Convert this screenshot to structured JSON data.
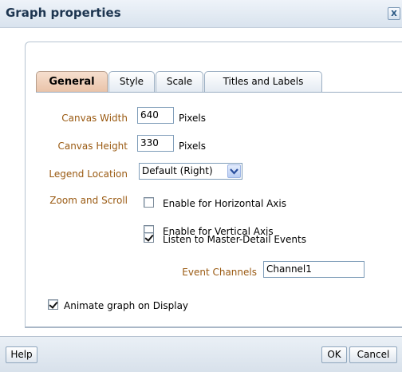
{
  "dialog": {
    "title": "Graph properties",
    "close_glyph": "x"
  },
  "tabs": [
    {
      "label": "General",
      "active": true
    },
    {
      "label": "Style",
      "active": false
    },
    {
      "label": "Scale",
      "active": false
    },
    {
      "label": "Titles and Labels",
      "active": false
    }
  ],
  "general": {
    "canvas_width": {
      "label": "Canvas Width",
      "value": "640",
      "unit": "Pixels"
    },
    "canvas_height": {
      "label": "Canvas Height",
      "value": "330",
      "unit": "Pixels"
    },
    "legend_location": {
      "label": "Legend Location",
      "value": "Default (Right)"
    },
    "zoom_scroll": {
      "label": "Zoom and Scroll",
      "horizontal": {
        "label": "Enable for Horizontal Axis",
        "checked": false
      },
      "vertical": {
        "label": "Enable for Vertical Axis",
        "checked": false
      },
      "master_detail": {
        "label": "Listen to Master-Detail Events",
        "checked": true
      }
    },
    "event_channels": {
      "label": "Event Channels",
      "value": "Channel1"
    },
    "animate": {
      "label": "Animate graph on Display",
      "checked": true
    }
  },
  "footer": {
    "help": "Help",
    "ok": "OK",
    "cancel": "Cancel"
  },
  "colors": {
    "label_text": "#9a5a12",
    "active_tab": "#e9c2a7",
    "title_text": "#1d3550"
  },
  "icons": {
    "close": "close-icon",
    "dropdown": "chevron-down-icon",
    "checkbox": "checkbox-icon"
  }
}
